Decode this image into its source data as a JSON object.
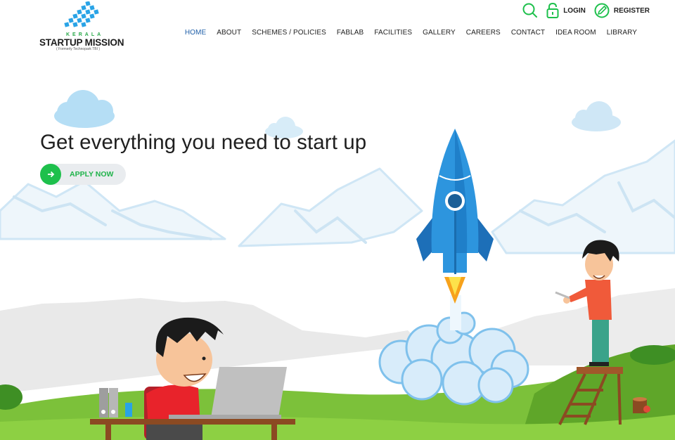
{
  "brand": {
    "kerala": "KERALA",
    "name": "STARTUP MISSION",
    "sub": "( Formerly Technopark TBI )",
    "colors": {
      "blue": "#29a3e6",
      "green": "#2aa84a"
    }
  },
  "topbar": {
    "search_icon": "search-icon",
    "login": "LOGIN",
    "register": "REGISTER",
    "accent": "#1ec04c"
  },
  "nav": {
    "home": "HOME",
    "about": "ABOUT",
    "schemes": "SCHEMES / POLICIES",
    "fablab": "FABLAB",
    "facilities": "FACILITIES",
    "gallery": "GALLERY",
    "careers": "CAREERS",
    "contact": "CONTACT",
    "idea_room": "IDEA ROOM",
    "library": "LIBRARY",
    "active": "HOME"
  },
  "hero": {
    "title": "Get everything you need to start up",
    "cta": "APPLY NOW"
  }
}
